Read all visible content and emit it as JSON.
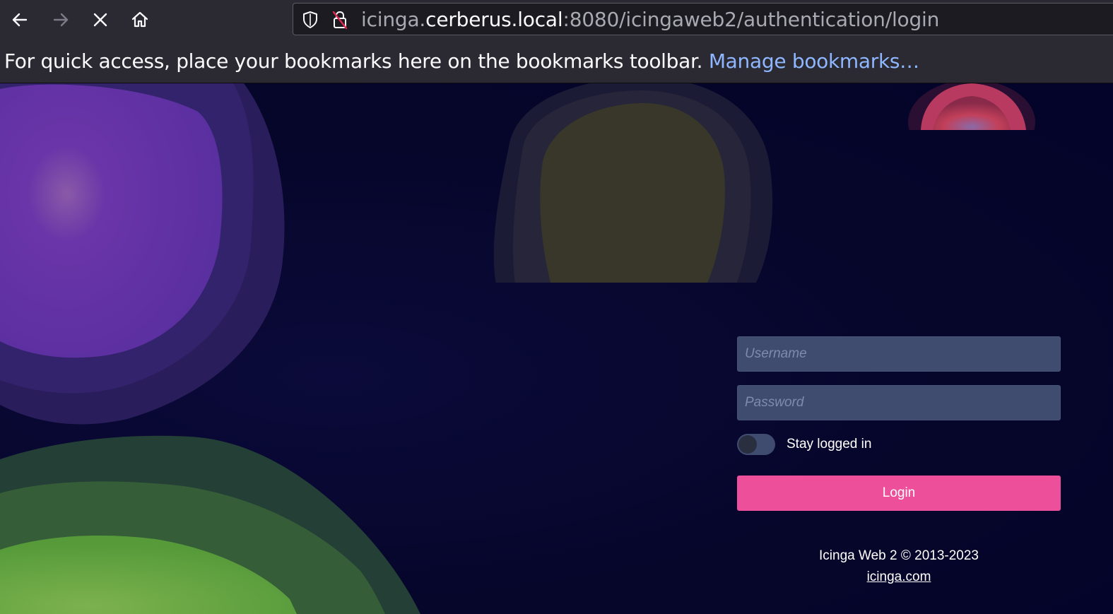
{
  "browser": {
    "nav": {
      "back_icon": "back-arrow-icon",
      "forward_icon": "forward-arrow-icon",
      "stop_icon": "close-icon",
      "home_icon": "home-icon"
    },
    "urlbar": {
      "prefix": "icinga.",
      "host": "cerberus.local",
      "suffix": ":8080/icingaweb2/authentication/login"
    },
    "bookmarks": {
      "message": "For quick access, place your bookmarks here on the bookmarks toolbar.",
      "link": "Manage bookmarks…"
    }
  },
  "login": {
    "username_placeholder": "Username",
    "password_placeholder": "Password",
    "stay_logged_in": "Stay logged in",
    "stay_logged_in_on": false,
    "login_button": "Login"
  },
  "footer": {
    "copyright": "Icinga Web 2 © 2013-2023",
    "link": "icinga.com"
  },
  "colors": {
    "accent": "#ee4f9b",
    "field_bg": "#3f4c70",
    "page_bg": "#06062b"
  }
}
